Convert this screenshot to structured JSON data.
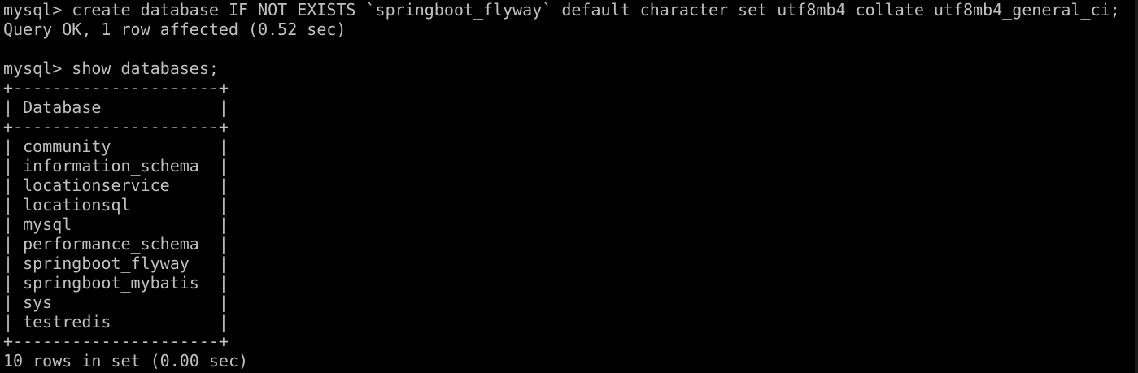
{
  "terminal": {
    "lines": [
      "mysql> create database IF NOT EXISTS `springboot_flyway` default character set utf8mb4 collate utf8mb4_general_ci;",
      "Query OK, 1 row affected (0.52 sec)",
      "",
      "mysql> show databases;",
      "+---------------------+",
      "| Database            |",
      "+---------------------+",
      "| community           |",
      "| information_schema  |",
      "| locationservice     |",
      "| locationsql         |",
      "| mysql               |",
      "| performance_schema  |",
      "| springboot_flyway   |",
      "| springboot_mybatis  |",
      "| sys                 |",
      "| testredis           |",
      "+---------------------+",
      "10 rows in set (0.00 sec)"
    ],
    "colors": {
      "background": "#000000",
      "text": "#c0c0c0"
    }
  }
}
